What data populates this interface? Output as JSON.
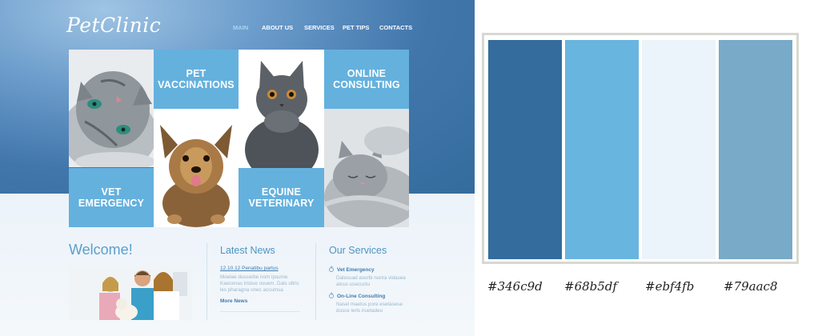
{
  "site": {
    "logo": "PetClinic",
    "nav": [
      {
        "label": "MAIN",
        "active": true
      },
      {
        "label": "ABOUT US",
        "active": false
      },
      {
        "label": "SERVICES",
        "active": false
      },
      {
        "label": "PET TIPS",
        "active": false
      },
      {
        "label": "CONTACTS",
        "active": false
      }
    ],
    "tiles": {
      "pet_vaccinations": "PET\nVACCINATIONS",
      "online_consulting": "ONLINE\nCONSULTING",
      "vet_emergency": "VET EMERGENCY",
      "equine_veterinary": "EQUINE\nVETERINARY"
    },
    "welcome": {
      "title": "Welcome!"
    },
    "news": {
      "title": "Latest News",
      "item_link": "12.10.12 Penatibu partus",
      "item_text": "Moelae duscerbe nom ipsume\nKaecenas tristue osuem. Dals ultric\nles pharagna onec accumsa",
      "more": "More News"
    },
    "services": {
      "title": "Our Services",
      "items": [
        {
          "label": "Vet Emergency",
          "text": "Dalesuad asorbi nunra vidasea\natcus usecuctu"
        },
        {
          "label": "On-Line Consulting",
          "text": "Nasel maelus pore esetasese\ndusce lerls iruetadeu"
        }
      ]
    }
  },
  "palette": {
    "swatches": [
      {
        "color": "#346c9d",
        "label": "#346c9d"
      },
      {
        "color": "#68b5df",
        "label": "#68b5df"
      },
      {
        "color": "#ebf4fb",
        "label": "#ebf4fb"
      },
      {
        "color": "#79aac8",
        "label": "#79aac8"
      }
    ]
  }
}
